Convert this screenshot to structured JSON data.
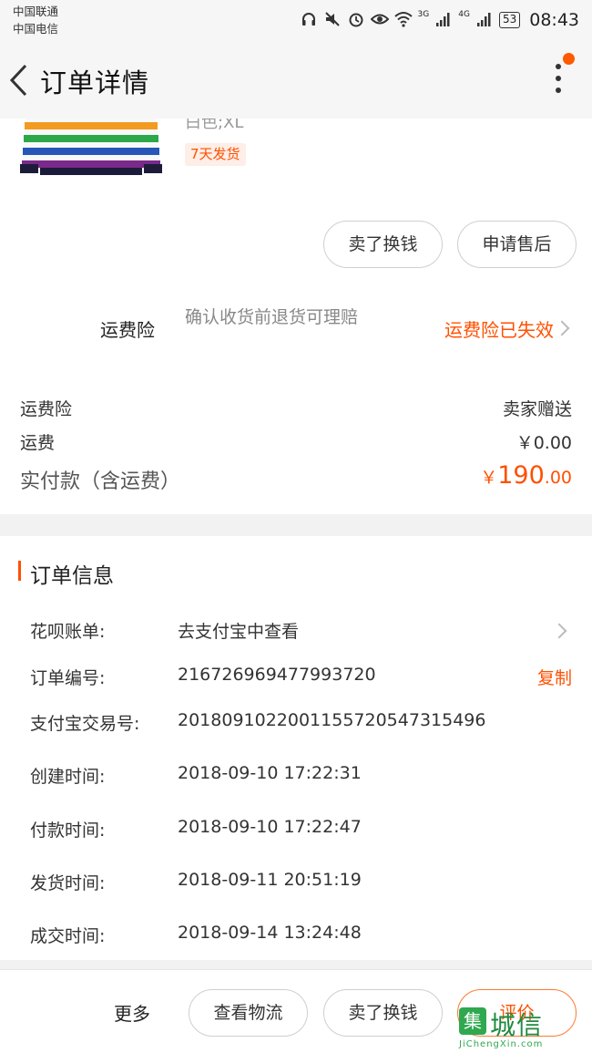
{
  "status_bar": {
    "carrier1": "中国联通",
    "carrier2": "中国电信",
    "battery": "53",
    "time": "08:43",
    "network1": "3G",
    "network2": "4G"
  },
  "header": {
    "title": "订单详情"
  },
  "product": {
    "sku": "白色;XL",
    "ship_tag": "7天发货"
  },
  "item_actions": {
    "sell_label": "卖了换钱",
    "after_sale_label": "申请售后"
  },
  "insurance": {
    "label": "运费险",
    "desc": "确认收货前退货可理赔",
    "status": "运费险已失效"
  },
  "fees": {
    "insurance_label": "运费险",
    "insurance_value": "卖家赠送",
    "shipping_label": "运费",
    "shipping_value": "￥0.00",
    "total_label": "实付款（含运费）",
    "total_currency": "￥",
    "total_int": "190",
    "total_dec": ".00"
  },
  "order_info": {
    "title": "订单信息",
    "rows": [
      {
        "key": "花呗账单:",
        "value": "去支付宝中查看"
      },
      {
        "key": "订单编号:",
        "value": "216726969477993720",
        "action": "复制"
      },
      {
        "key": "支付宝交易号:",
        "value": "2018091022001155720547315496"
      },
      {
        "key": "创建时间:",
        "value": "2018-09-10 17:22:31"
      },
      {
        "key": "付款时间:",
        "value": "2018-09-10 17:22:47"
      },
      {
        "key": "发货时间:",
        "value": "2018-09-11 20:51:19"
      },
      {
        "key": "成交时间:",
        "value": "2018-09-14 13:24:48"
      }
    ]
  },
  "bottom_bar": {
    "more": "更多",
    "logistics": "查看物流",
    "sell": "卖了换钱",
    "review": "评价"
  },
  "watermark": {
    "text": "城信",
    "logo_char": "集",
    "sub": "JiChengXin.com"
  },
  "colors": {
    "accent": "#ff5000",
    "page_bg": "#f2f2f2",
    "card_bg": "#ffffff"
  }
}
